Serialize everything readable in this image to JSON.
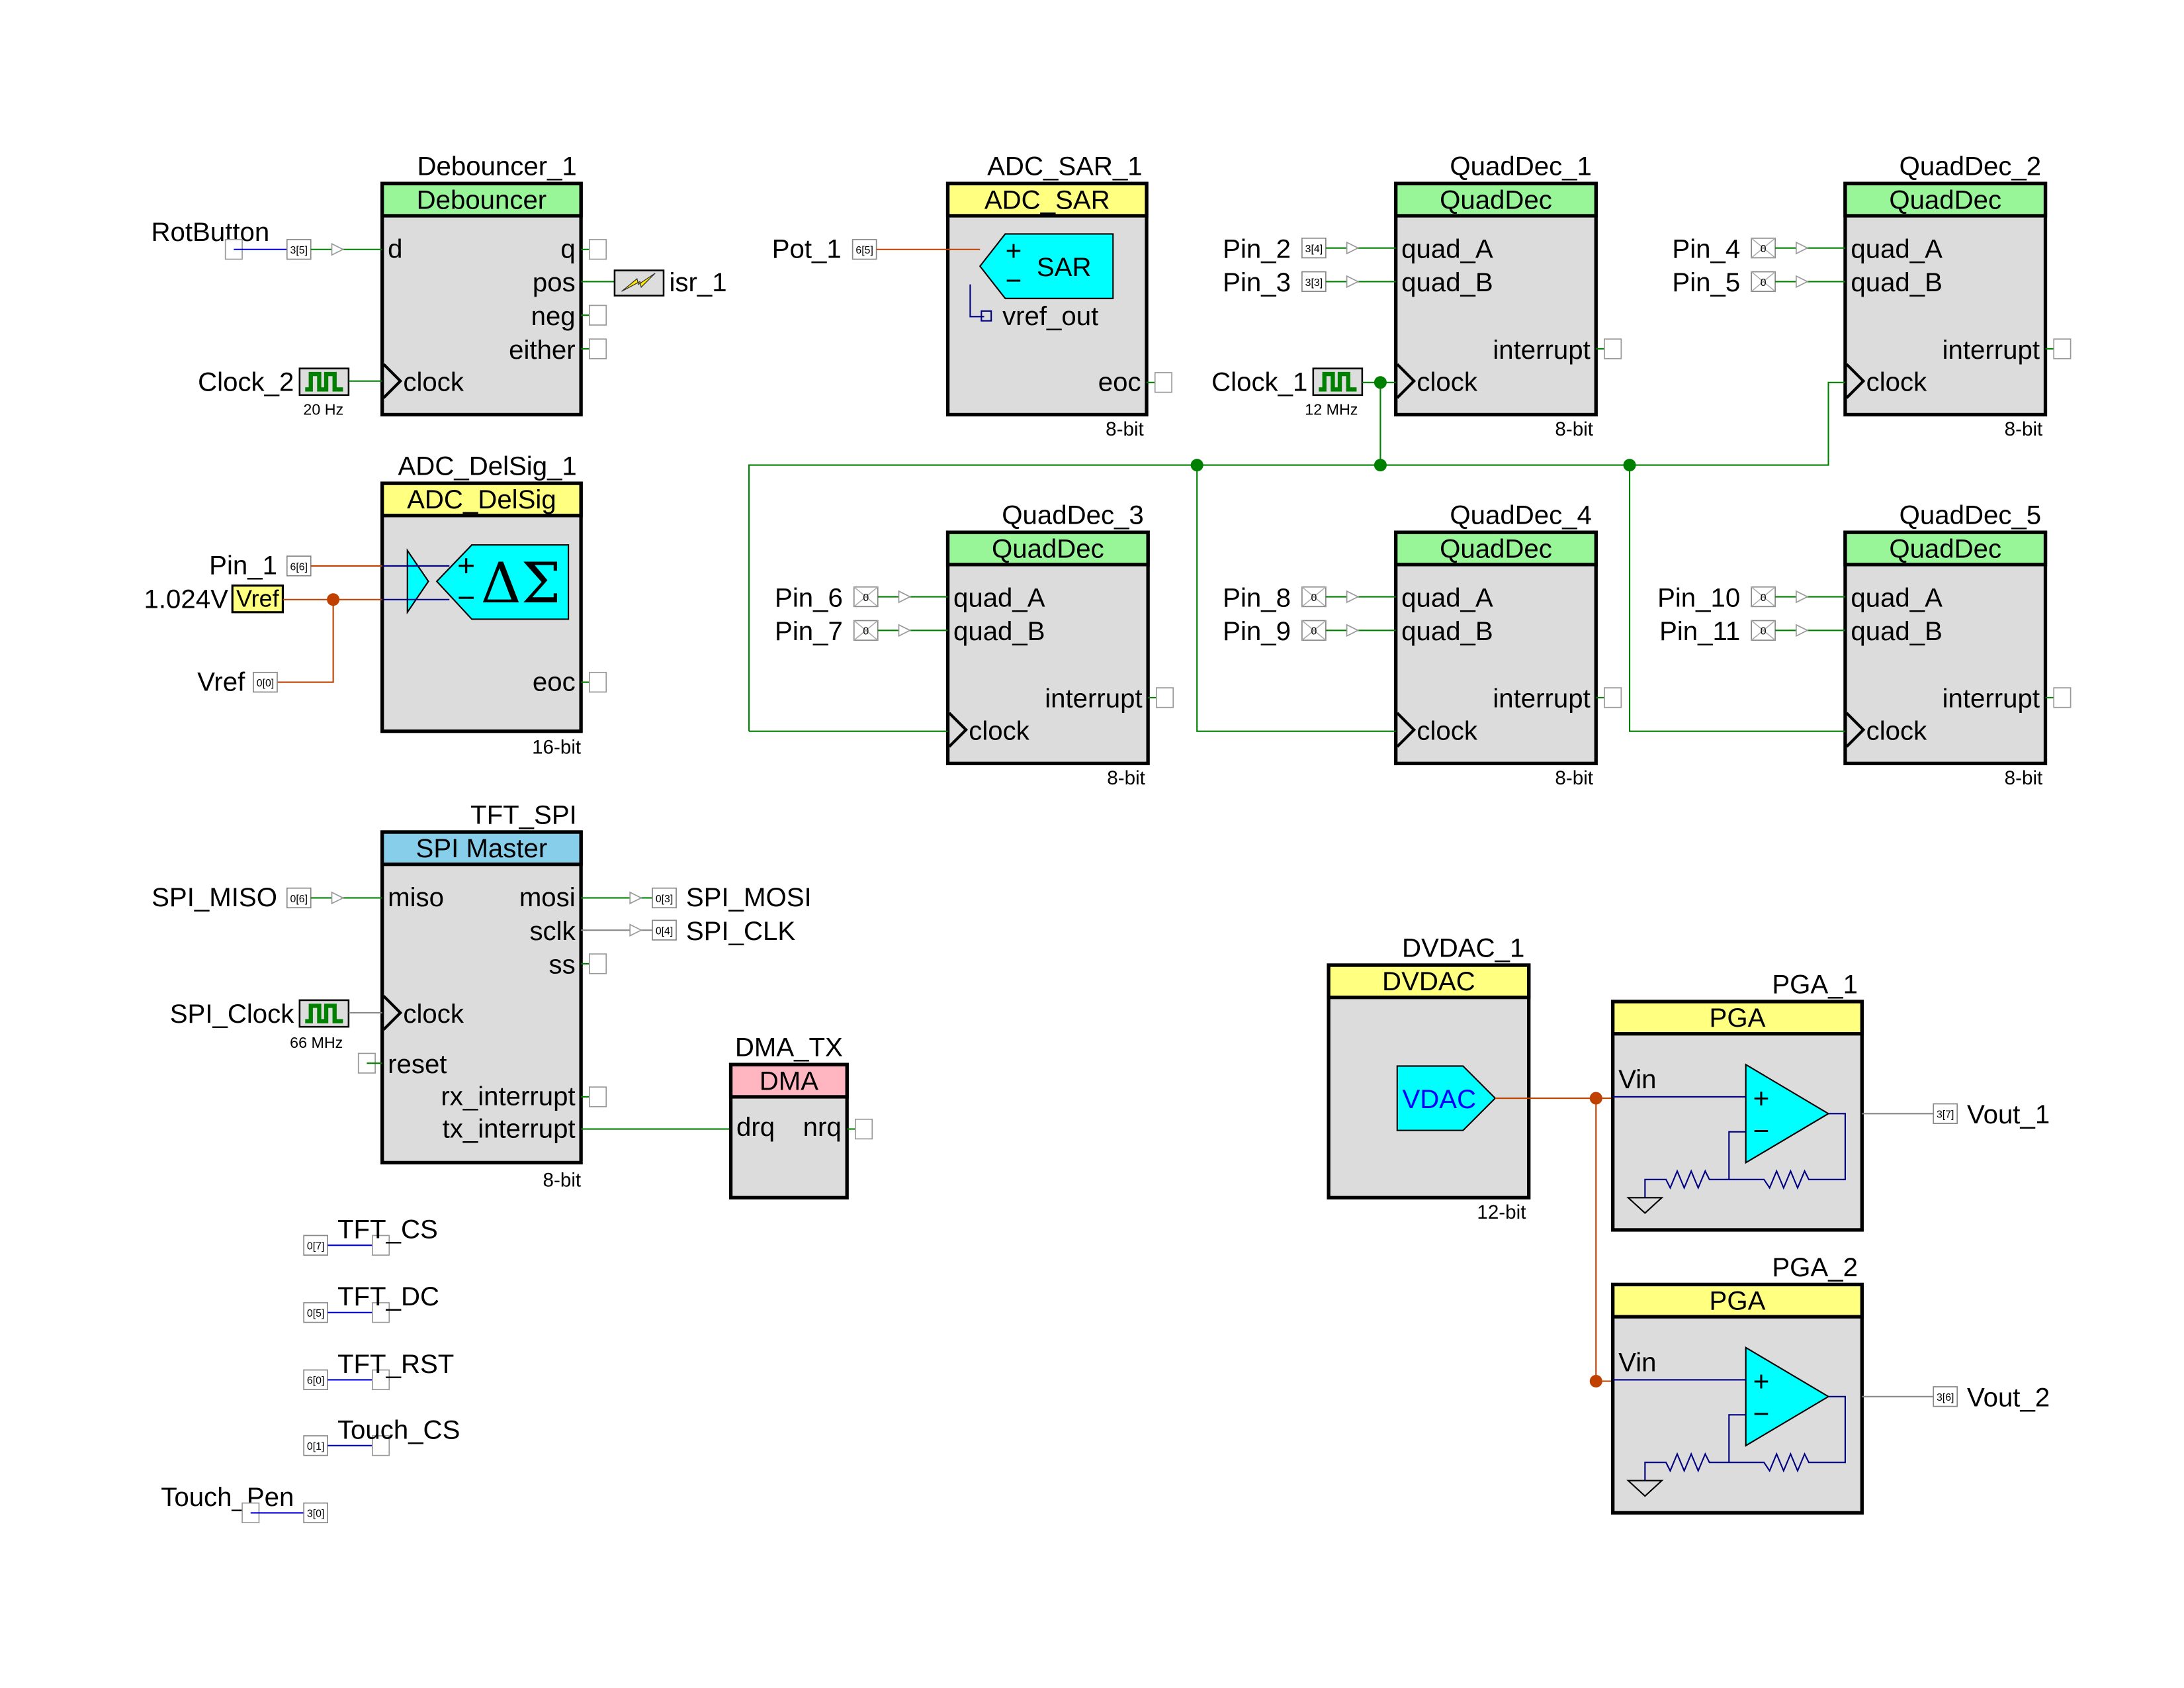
{
  "colors": {
    "digital_wire": "#008000",
    "analog_wire": "#C04000",
    "internal_wire": "#000080",
    "pin_wire": "#0000D0",
    "header_green": "#98F598",
    "header_yellow": "#FFFF80",
    "header_blue": "#87CEEB",
    "header_pink": "#FFB6C1",
    "body_gray": "#DCDCDC",
    "symbol_cyan": "#00FFFF"
  },
  "components": {
    "debouncer": {
      "instance": "Debouncer_1",
      "type": "Debouncer",
      "ports": [
        "d",
        "clock",
        "q",
        "pos",
        "neg",
        "either"
      ]
    },
    "adc_sar": {
      "instance": "ADC_SAR_1",
      "type": "ADC_SAR",
      "symbol": "SAR",
      "plus": "+",
      "minus": "−",
      "ports": [
        "vref_out",
        "eoc"
      ],
      "resolution": "8-bit"
    },
    "adc_delsig": {
      "instance": "ADC_DelSig_1",
      "type": "ADC_DelSig",
      "symbol": "ΔΣ",
      "plus": "+",
      "minus": "−",
      "ports": [
        "eoc"
      ],
      "resolution": "16-bit"
    },
    "quaddec_1": {
      "instance": "QuadDec_1",
      "type": "QuadDec",
      "ports": [
        "quad_A",
        "quad_B",
        "interrupt",
        "clock"
      ],
      "resolution": "8-bit"
    },
    "quaddec_2": {
      "instance": "QuadDec_2",
      "type": "QuadDec",
      "ports": [
        "quad_A",
        "quad_B",
        "interrupt",
        "clock"
      ],
      "resolution": "8-bit"
    },
    "quaddec_3": {
      "instance": "QuadDec_3",
      "type": "QuadDec",
      "ports": [
        "quad_A",
        "quad_B",
        "interrupt",
        "clock"
      ],
      "resolution": "8-bit"
    },
    "quaddec_4": {
      "instance": "QuadDec_4",
      "type": "QuadDec",
      "ports": [
        "quad_A",
        "quad_B",
        "interrupt",
        "clock"
      ],
      "resolution": "8-bit"
    },
    "quaddec_5": {
      "instance": "QuadDec_5",
      "type": "QuadDec",
      "ports": [
        "quad_A",
        "quad_B",
        "interrupt",
        "clock"
      ],
      "resolution": "8-bit"
    },
    "tft_spi": {
      "instance": "TFT_SPI",
      "type": "SPI Master",
      "ports": [
        "miso",
        "clock",
        "reset",
        "mosi",
        "sclk",
        "ss",
        "rx_interrupt",
        "tx_interrupt"
      ],
      "resolution": "8-bit"
    },
    "dma_tx": {
      "instance": "DMA_TX",
      "type": "DMA",
      "ports": [
        "drq",
        "nrq"
      ]
    },
    "dvdac": {
      "instance": "DVDAC_1",
      "type": "DVDAC",
      "symbol": "VDAC",
      "resolution": "12-bit"
    },
    "pga_1": {
      "instance": "PGA_1",
      "type": "PGA",
      "plus": "+",
      "minus": "−",
      "ports": [
        "Vin"
      ]
    },
    "pga_2": {
      "instance": "PGA_2",
      "type": "PGA",
      "plus": "+",
      "minus": "−",
      "ports": [
        "Vin"
      ]
    }
  },
  "pins": {
    "rotbutton": {
      "name": "RotButton",
      "port": "3[5]"
    },
    "pot_1": {
      "name": "Pot_1",
      "port": "6[5]"
    },
    "pin_1": {
      "name": "Pin_1",
      "port": "6[6]"
    },
    "vref_pin": {
      "name": "Vref",
      "port": "0[0]"
    },
    "pin_2": {
      "name": "Pin_2",
      "port": "3[4]"
    },
    "pin_3": {
      "name": "Pin_3",
      "port": "3[3]"
    },
    "pin_4": {
      "name": "Pin_4",
      "port": "0"
    },
    "pin_5": {
      "name": "Pin_5",
      "port": "0"
    },
    "pin_6": {
      "name": "Pin_6",
      "port": "0"
    },
    "pin_7": {
      "name": "Pin_7",
      "port": "0"
    },
    "pin_8": {
      "name": "Pin_8",
      "port": "0"
    },
    "pin_9": {
      "name": "Pin_9",
      "port": "0"
    },
    "pin_10": {
      "name": "Pin_10",
      "port": "0"
    },
    "pin_11": {
      "name": "Pin_11",
      "port": "0"
    },
    "spi_miso": {
      "name": "SPI_MISO",
      "port": "0[6]"
    },
    "spi_mosi": {
      "name": "SPI_MOSI",
      "port": "0[3]"
    },
    "spi_clk": {
      "name": "SPI_CLK",
      "port": "0[4]"
    },
    "tft_cs": {
      "name": "TFT_CS",
      "port": "0[7]"
    },
    "tft_dc": {
      "name": "TFT_DC",
      "port": "0[5]"
    },
    "tft_rst": {
      "name": "TFT_RST",
      "port": "6[0]"
    },
    "touch_cs": {
      "name": "Touch_CS",
      "port": "0[1]"
    },
    "touch_pen": {
      "name": "Touch_Pen",
      "port": "3[0]"
    },
    "vout_1": {
      "name": "Vout_1",
      "port": "3[7]"
    },
    "vout_2": {
      "name": "Vout_2",
      "port": "3[6]"
    }
  },
  "clocks": {
    "clock_2": {
      "name": "Clock_2",
      "freq": "20 Hz"
    },
    "clock_1": {
      "name": "Clock_1",
      "freq": "12 MHz"
    },
    "spi_clock": {
      "name": "SPI_Clock",
      "freq": "66 MHz"
    }
  },
  "isr": {
    "name": "isr_1"
  },
  "vref": {
    "voltage": "1.024V",
    "label": "Vref"
  }
}
